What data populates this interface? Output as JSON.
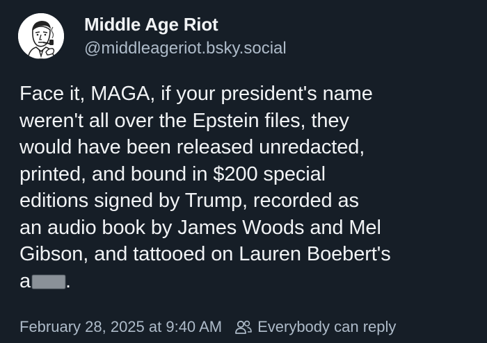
{
  "post": {
    "author": {
      "display_name": "Middle Age Riot",
      "handle": "@middleageriot.bsky.social",
      "avatar": "cartoon-man-with-pipe-avatar"
    },
    "body": {
      "lines": [
        "Face it, MAGA, if your president's name",
        "weren't all over the Epstein files, they",
        "would have been released unredacted,",
        "printed, and bound in $200 special",
        "editions signed by Trump, recorded as",
        "an audio book by James Woods and Mel",
        "Gibson, and tattooed on Lauren Boebert's"
      ],
      "last_line_start": "a",
      "last_line_end": "."
    },
    "footer": {
      "timestamp": "February 28, 2025 at 9:40 AM",
      "reply_setting": "Everybody can reply",
      "reply_icon": "people-icon"
    }
  },
  "colors": {
    "background": "#161e27",
    "text": "#f1f3f5",
    "muted_text": "#aebbc9"
  }
}
